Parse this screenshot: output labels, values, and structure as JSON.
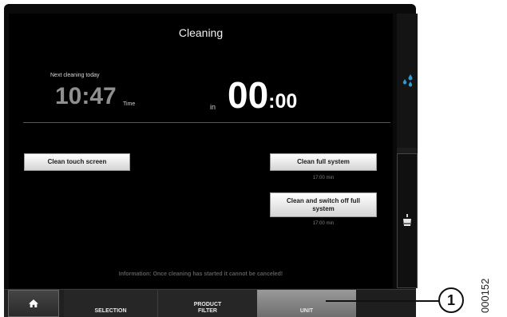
{
  "screen": {
    "title": "Cleaning",
    "next_cleaning_label": "Next cleaning today",
    "next_time": "10:47",
    "time_label": "Time",
    "in_label": "in",
    "countdown_big": "00",
    "countdown_small": ":00"
  },
  "actions": {
    "clean_touch_screen": "Clean touch screen",
    "clean_full_system": "Clean full system",
    "clean_full_system_duration": "17:00 min",
    "clean_and_switch_off": "Clean and switch off full system",
    "clean_and_switch_off_duration": "17:00 min"
  },
  "information": "Information: Once cleaning has started it cannot be canceled!",
  "side_panel": {
    "upper_icon": "water-drops-icon",
    "lower_icon": "cup-icon"
  },
  "nav": {
    "home_icon": "home-icon",
    "selection": "SELECTION",
    "product_filter_line1": "PRODUCT",
    "product_filter_line2": "FILTER",
    "unit": "UNIT"
  },
  "annotation": {
    "callout_number": "1",
    "figure_id": "000152"
  },
  "colors": {
    "screen_bg": "#000000",
    "accent_drops": "#2f9bd6",
    "active_tab": "#8a8a8a"
  }
}
